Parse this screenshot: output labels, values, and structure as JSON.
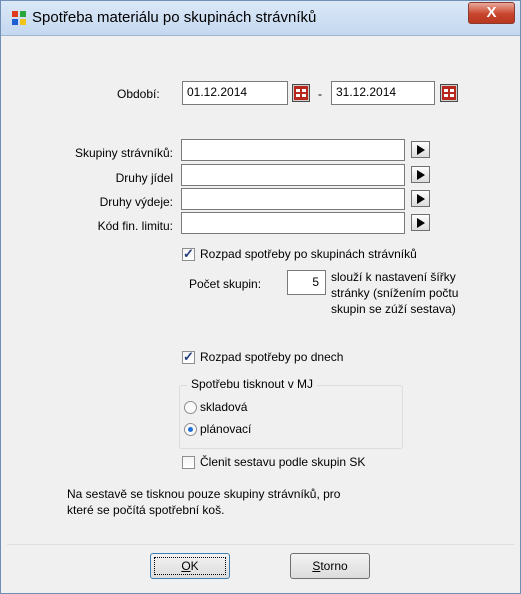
{
  "window": {
    "title": "Spotřeba materiálu po skupinách strávníků",
    "close_label": "X"
  },
  "period": {
    "label": "Období:",
    "from": "01.12.2014",
    "separator": "-",
    "to": "31.12.2014"
  },
  "filters": [
    {
      "label": "Skupiny strávníků:",
      "value": ""
    },
    {
      "label": "Druhy jídel",
      "value": ""
    },
    {
      "label": "Druhy výdeje:",
      "value": ""
    },
    {
      "label": "Kód fin. limitu:",
      "value": ""
    }
  ],
  "options": {
    "split_by_groups": {
      "label": "Rozpad spotřeby po skupinách strávníků",
      "checked": true
    },
    "group_count": {
      "label": "Počet skupin:",
      "value": "5",
      "hint": [
        "slouží k nastavení šířky",
        "stránky (snížením počtu",
        "skupin se zúží sestava)"
      ]
    },
    "split_by_days": {
      "label": "Rozpad spotřeby po dnech",
      "checked": true
    },
    "unit_group": {
      "title": "Spotřebu tisknout v MJ",
      "items": [
        {
          "label": "skladová",
          "selected": false
        },
        {
          "label": "plánovací",
          "selected": true
        }
      ]
    },
    "by_sk": {
      "label": "Členit sestavu podle skupin SK",
      "checked": false
    }
  },
  "note": [
    "Na sestavě se tisknou pouze skupiny strávníků, pro",
    "které se počítá spotřební koš."
  ],
  "buttons": {
    "ok": {
      "mnemonic": "O",
      "rest": "K"
    },
    "cancel": {
      "mnemonic": "S",
      "rest": "torno"
    }
  }
}
